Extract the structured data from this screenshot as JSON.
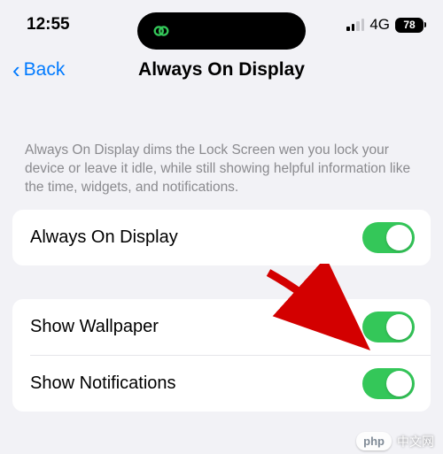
{
  "status": {
    "time": "12:55",
    "network": "4G",
    "battery": "78"
  },
  "nav": {
    "back_label": "Back",
    "title": "Always On Display"
  },
  "description": "Always On Display dims the Lock Screen wen you lock your device or leave it idle, while still showing helpful information like the time, widgets, and notifications.",
  "settings": {
    "always_on": {
      "label": "Always On Display",
      "enabled": true
    },
    "wallpaper": {
      "label": "Show Wallpaper",
      "enabled": true
    },
    "notifications": {
      "label": "Show Notifications",
      "enabled": true
    }
  },
  "watermark": {
    "logo": "php",
    "text": "中文网"
  }
}
